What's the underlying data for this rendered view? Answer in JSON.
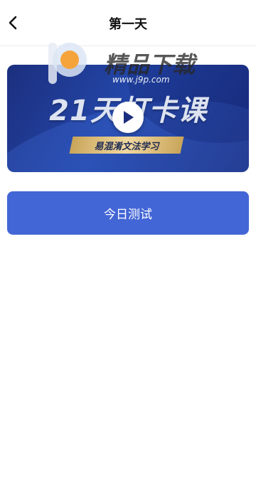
{
  "header": {
    "title": "第一天",
    "back_icon": "chevron-left-icon"
  },
  "video_card": {
    "title": "21天打卡课",
    "subtitle": "易混淆文法学习",
    "play_icon": "play-icon",
    "colors": {
      "bg": "#2346a8",
      "banner": "#e3c584"
    }
  },
  "watermark": {
    "brand": "精品下载",
    "url": "www.j9p.com"
  },
  "actions": {
    "test_label": "今日测试",
    "accent_color": "#4366d6"
  }
}
